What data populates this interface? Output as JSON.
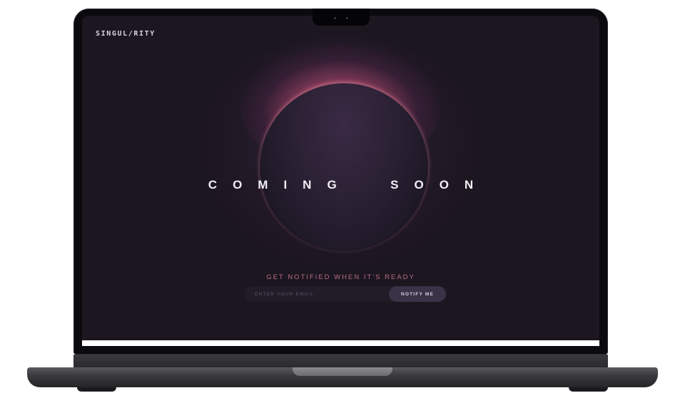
{
  "site": {
    "logo": "SINGUL/RITY"
  },
  "hero": {
    "headline": "COMING  SOON",
    "notify_label": "GET NOTIFIED WHEN IT'S READY"
  },
  "signup": {
    "email_placeholder": "ENTER YOUR EMAIL",
    "button_label": "NOTIFY ME"
  },
  "colors": {
    "background": "#1c1620",
    "accent_glow": "#ee6e82",
    "notify_label": "#b86b88",
    "button": "#3a3348"
  }
}
